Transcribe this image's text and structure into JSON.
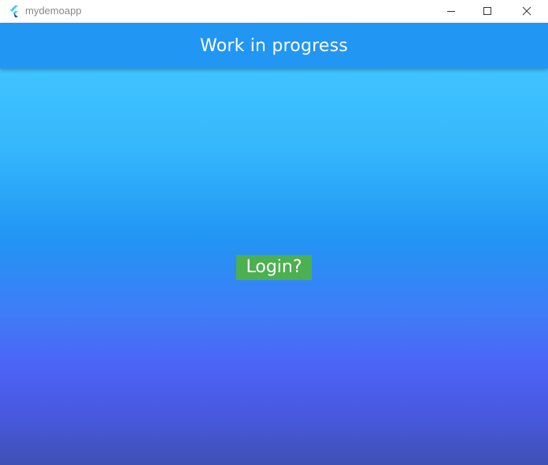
{
  "window": {
    "title": "mydemoapp",
    "icon": "flutter-logo-icon",
    "controls": {
      "minimize_icon": "minimize-icon",
      "maximize_icon": "maximize-icon",
      "close_icon": "close-icon"
    }
  },
  "appbar": {
    "title": "Work in progress",
    "color": "#2196f3"
  },
  "main": {
    "login_label": "Login?",
    "login_color": "#4caf50",
    "gradient": [
      "#40c4ff",
      "#2196f3",
      "#536dfe",
      "#3f51b5"
    ]
  }
}
